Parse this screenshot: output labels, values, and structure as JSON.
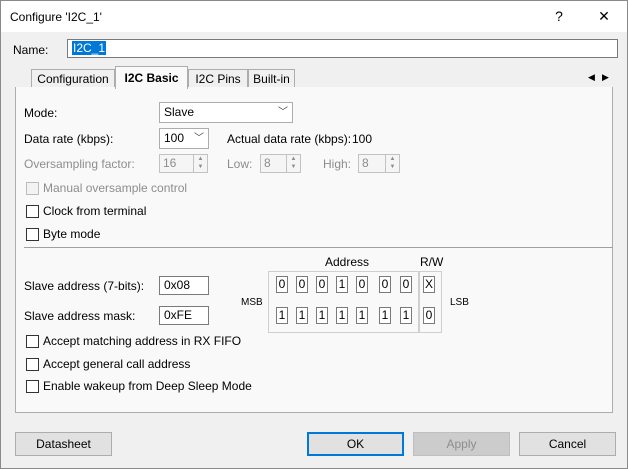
{
  "window": {
    "title": "Configure 'I2C_1'",
    "help_glyph": "?",
    "close_glyph": "✕"
  },
  "name_field": {
    "label": "Name:",
    "value": "I2C_1"
  },
  "tabs": [
    {
      "label": "Configuration",
      "active": false
    },
    {
      "label": "I2C Basic",
      "active": true
    },
    {
      "label": "I2C Pins",
      "active": false
    },
    {
      "label": "Built-in",
      "active": false
    }
  ],
  "tab_scroll": {
    "left": "◀",
    "right": "▶"
  },
  "basic": {
    "mode_label": "Mode:",
    "mode_value": "Slave",
    "data_rate_label": "Data rate (kbps):",
    "data_rate_value": "100",
    "actual_rate_label": "Actual data rate (kbps):",
    "actual_rate_value": "100",
    "oversampling_label": "Oversampling factor:",
    "oversampling_value": "16",
    "low_label": "Low:",
    "low_value": "8",
    "high_label": "High:",
    "high_value": "8",
    "manual_oversample_label": "Manual oversample control",
    "clock_from_terminal_label": "Clock from terminal",
    "byte_mode_label": "Byte mode",
    "address_header": "Address",
    "rw_header": "R/W",
    "slave_address_label": "Slave address (7-bits):",
    "slave_address_value": "0x08",
    "slave_mask_label": "Slave address mask:",
    "slave_mask_value": "0xFE",
    "msb_label": "MSB",
    "lsb_label": "LSB",
    "address_bits": [
      "0",
      "0",
      "0",
      "1",
      "0",
      "0",
      "0"
    ],
    "address_rw": "X",
    "mask_bits": [
      "1",
      "1",
      "1",
      "1",
      "1",
      "1",
      "1"
    ],
    "mask_rw": "0",
    "accept_matching_label": "Accept matching address in RX FIFO",
    "accept_general_label": "Accept general call address",
    "enable_wakeup_label": "Enable wakeup from Deep Sleep Mode"
  },
  "buttons": {
    "datasheet": "Datasheet",
    "ok": "OK",
    "apply": "Apply",
    "cancel": "Cancel"
  }
}
